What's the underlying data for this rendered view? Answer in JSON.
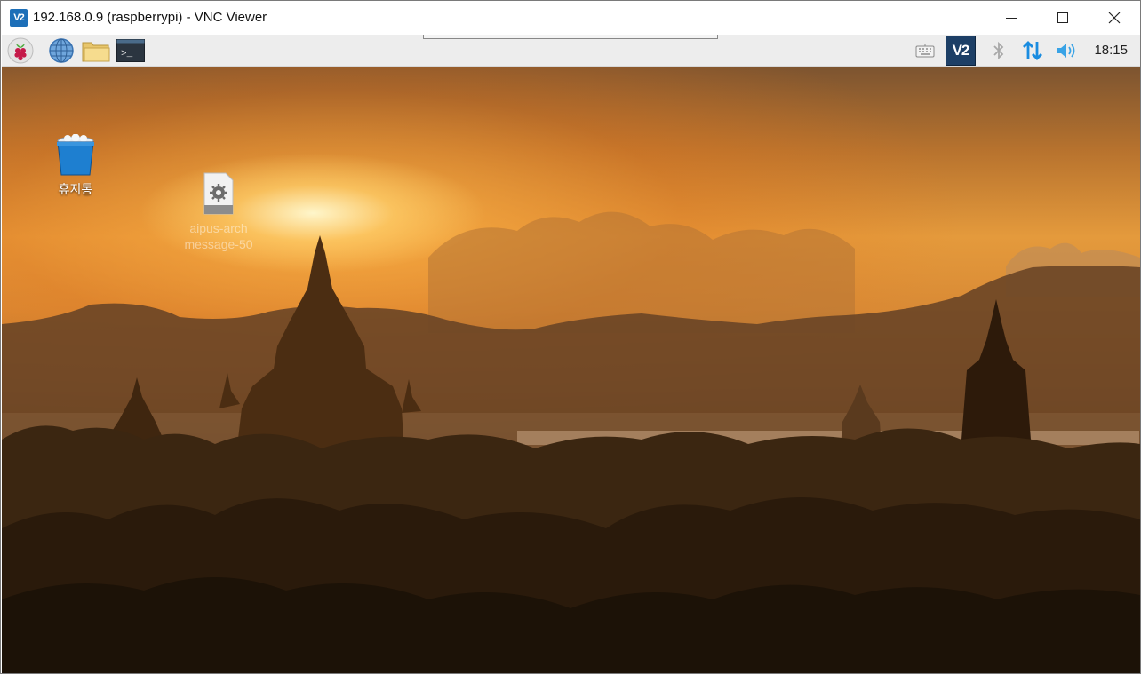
{
  "window": {
    "title": "192.168.0.9 (raspberrypi) - VNC Viewer",
    "app_icon": "vnc-viewer-icon",
    "app_icon_text": "V2",
    "controls": [
      "minimize-icon",
      "maximize-icon",
      "close-icon"
    ]
  },
  "panel": {
    "launchers": [
      "raspberry-menu-icon",
      "web-browser-icon",
      "file-manager-icon",
      "terminal-icon"
    ],
    "terminal_glyph": ">_",
    "tray": [
      "keyboard-icon",
      "vnc-server-icon",
      "bluetooth-icon",
      "network-icon",
      "volume-icon"
    ],
    "vnc_tray_text": "V2",
    "clock": "18:15"
  },
  "desktop": {
    "icons": [
      {
        "name": "trash",
        "label": "휴지통",
        "icon": "trash-bucket-icon"
      },
      {
        "name": "file",
        "label_line1": "aipus-arch",
        "label_line2": "message-50",
        "icon": "settings-file-icon"
      }
    ]
  },
  "colors": {
    "vnc_blue": "#1d6fb8",
    "network_arrows": "#1a8ce0",
    "volume": "#39a3e6",
    "panel_bg": "#ededed"
  }
}
